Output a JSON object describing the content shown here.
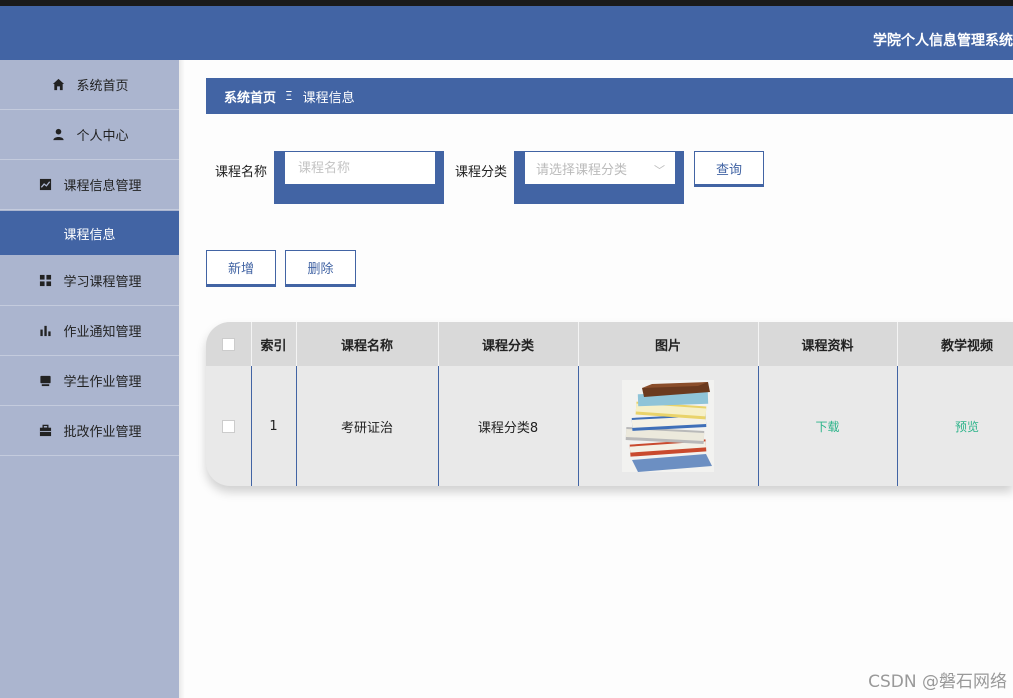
{
  "header": {
    "app_title": "学院个人信息管理系统"
  },
  "sidebar": {
    "items": [
      {
        "label": "系统首页",
        "icon": "home-icon"
      },
      {
        "label": "个人中心",
        "icon": "user-icon"
      },
      {
        "label": "课程信息管理",
        "icon": "chart-line-icon"
      },
      {
        "label": "课程信息",
        "icon": "",
        "active": true
      },
      {
        "label": "学习课程管理",
        "icon": "grid-icon"
      },
      {
        "label": "作业通知管理",
        "icon": "bar-chart-icon"
      },
      {
        "label": "学生作业管理",
        "icon": "tray-icon"
      },
      {
        "label": "批改作业管理",
        "icon": "briefcase-icon"
      }
    ]
  },
  "breadcrumb": {
    "home": "系统首页",
    "separator": "Ξ",
    "current": "课程信息"
  },
  "search": {
    "name_label": "课程名称",
    "name_placeholder": "课程名称",
    "category_label": "课程分类",
    "category_placeholder": "请选择课程分类",
    "query_button": "查询"
  },
  "actions": {
    "add_button": "新增",
    "delete_button": "删除"
  },
  "table": {
    "headers": [
      "索引",
      "课程名称",
      "课程分类",
      "图片",
      "课程资料",
      "教学视频"
    ],
    "rows": [
      {
        "index": "1",
        "course_name": "考研证治",
        "category": "课程分类8",
        "material_link": "下载",
        "video_link": "预览"
      }
    ]
  },
  "watermark": "CSDN @磐石网络",
  "colors": {
    "primary": "#4264a4",
    "sidebar": "#abb5cf",
    "link": "#2db48a"
  }
}
